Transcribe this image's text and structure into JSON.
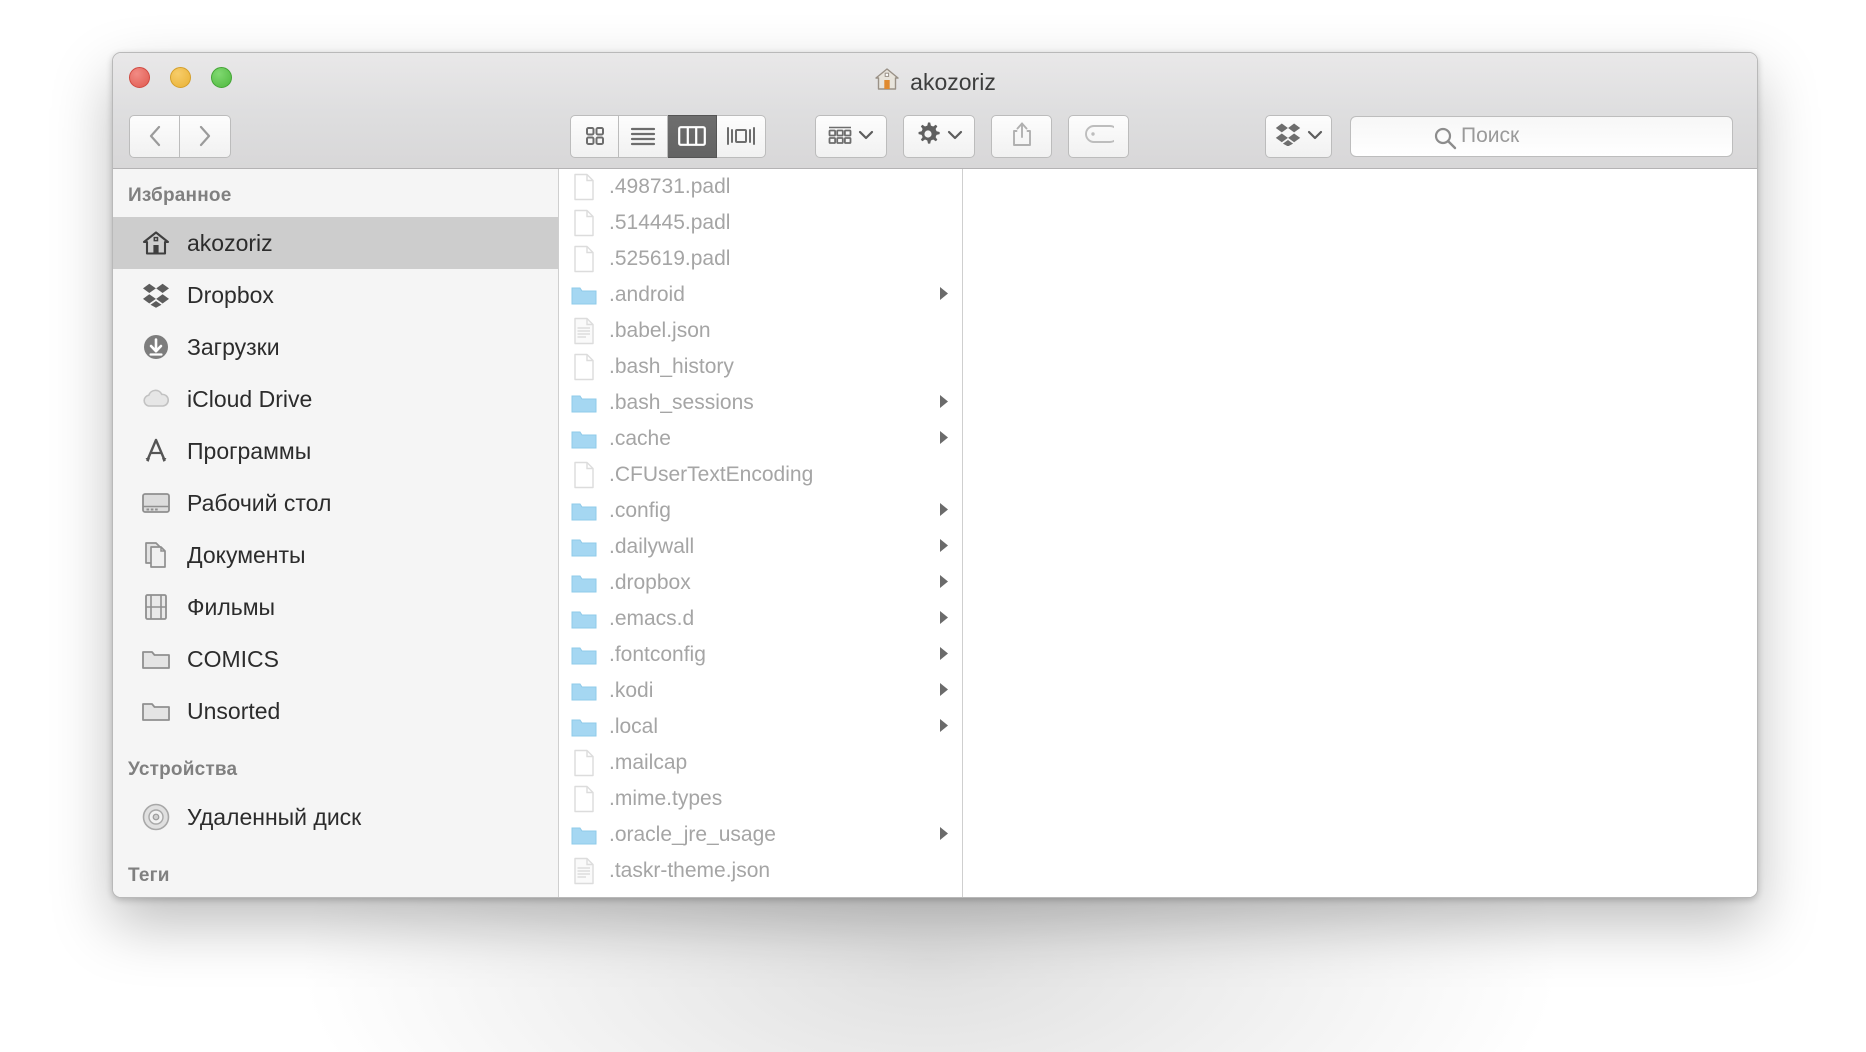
{
  "window": {
    "title": "akozoriz",
    "title_icon": "home-icon",
    "traffic_lights": [
      "close",
      "minimize",
      "maximize"
    ]
  },
  "toolbar": {
    "back_label": "Back",
    "forward_label": "Forward",
    "views": [
      {
        "name": "icon-view",
        "icon": "grid-icon",
        "active": false
      },
      {
        "name": "list-view",
        "icon": "list-icon",
        "active": false
      },
      {
        "name": "column-view",
        "icon": "columns-icon",
        "active": true
      },
      {
        "name": "coverflow-view",
        "icon": "coverflow-icon",
        "active": false
      }
    ],
    "arrange": {
      "icon": "arrange-icon",
      "has_chevron": true
    },
    "action": {
      "icon": "gear-icon",
      "has_chevron": true
    },
    "share": {
      "icon": "share-icon"
    },
    "tag": {
      "icon": "tag-icon"
    },
    "dropbox": {
      "icon": "dropbox-icon",
      "has_chevron": true
    }
  },
  "search": {
    "icon": "search-icon",
    "placeholder": "Поиск",
    "value": ""
  },
  "sidebar": {
    "sections": [
      {
        "header": "Избранное",
        "items": [
          {
            "label": "akozoriz",
            "icon": "home-icon",
            "selected": true
          },
          {
            "label": "Dropbox",
            "icon": "dropbox-icon",
            "selected": false
          },
          {
            "label": "Загрузки",
            "icon": "downloads-icon",
            "selected": false
          },
          {
            "label": "iCloud Drive",
            "icon": "cloud-icon",
            "selected": false
          },
          {
            "label": "Программы",
            "icon": "apps-icon",
            "selected": false
          },
          {
            "label": "Рабочий стол",
            "icon": "desktop-icon",
            "selected": false
          },
          {
            "label": "Документы",
            "icon": "documents-icon",
            "selected": false
          },
          {
            "label": "Фильмы",
            "icon": "movies-icon",
            "selected": false
          },
          {
            "label": "COMICS",
            "icon": "folder-icon",
            "selected": false
          },
          {
            "label": "Unsorted",
            "icon": "folder-icon",
            "selected": false
          }
        ]
      },
      {
        "header": "Устройства",
        "items": [
          {
            "label": "Удаленный диск",
            "icon": "disc-icon",
            "selected": false
          }
        ]
      },
      {
        "header": "Теги",
        "items": []
      }
    ]
  },
  "file_list": [
    {
      "name": ".498731.padl",
      "type": "file",
      "has_children": false
    },
    {
      "name": ".514445.padl",
      "type": "file",
      "has_children": false
    },
    {
      "name": ".525619.padl",
      "type": "file",
      "has_children": false
    },
    {
      "name": ".android",
      "type": "folder",
      "has_children": true
    },
    {
      "name": ".babel.json",
      "type": "text-file",
      "has_children": false
    },
    {
      "name": ".bash_history",
      "type": "file",
      "has_children": false
    },
    {
      "name": ".bash_sessions",
      "type": "folder",
      "has_children": true
    },
    {
      "name": ".cache",
      "type": "folder",
      "has_children": true
    },
    {
      "name": ".CFUserTextEncoding",
      "type": "file",
      "has_children": false
    },
    {
      "name": ".config",
      "type": "folder",
      "has_children": true
    },
    {
      "name": ".dailywall",
      "type": "folder",
      "has_children": true
    },
    {
      "name": ".dropbox",
      "type": "folder",
      "has_children": true
    },
    {
      "name": ".emacs.d",
      "type": "folder",
      "has_children": true
    },
    {
      "name": ".fontconfig",
      "type": "folder",
      "has_children": true
    },
    {
      "name": ".kodi",
      "type": "folder",
      "has_children": true
    },
    {
      "name": ".local",
      "type": "folder",
      "has_children": true
    },
    {
      "name": ".mailcap",
      "type": "file",
      "has_children": false
    },
    {
      "name": ".mime.types",
      "type": "file",
      "has_children": false
    },
    {
      "name": ".oracle_jre_usage",
      "type": "folder",
      "has_children": true
    },
    {
      "name": ".taskr-theme.json",
      "type": "text-file",
      "has_children": false
    }
  ],
  "colors": {
    "folder_blue": "#9fd4f0",
    "selected_row": "#cdcdcd",
    "file_text": "#a5a5a5",
    "sidebar_bg": "#f5f5f5"
  }
}
